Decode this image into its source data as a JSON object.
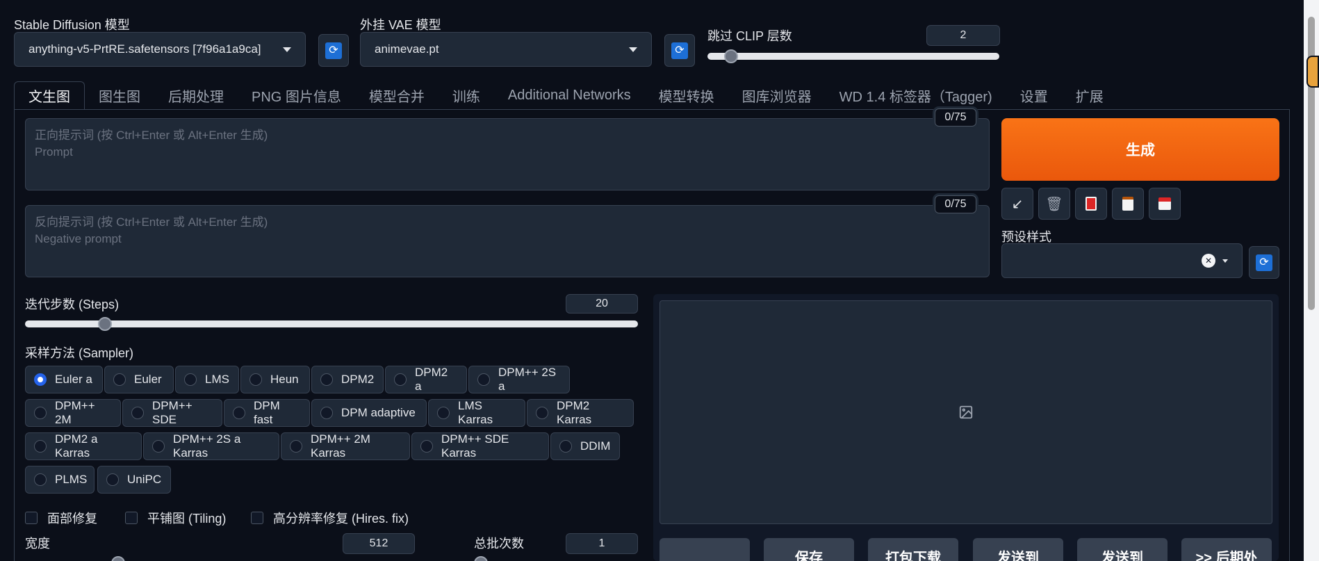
{
  "models": {
    "sd_label": "Stable Diffusion 模型",
    "sd_value": "anything-v5-PrtRE.safetensors [7f96a1a9ca]",
    "vae_label": "外挂 VAE 模型",
    "vae_value": "animevae.pt",
    "clip_label": "跳过 CLIP 层数",
    "clip_value": "2",
    "clip_fraction": 0.08
  },
  "tabs": [
    {
      "label": "文生图",
      "active": true
    },
    {
      "label": "图生图"
    },
    {
      "label": "后期处理"
    },
    {
      "label": "PNG 图片信息"
    },
    {
      "label": "模型合并"
    },
    {
      "label": "训练"
    },
    {
      "label": "Additional Networks"
    },
    {
      "label": "模型转换"
    },
    {
      "label": "图库浏览器"
    },
    {
      "label": "WD 1.4 标签器（Tagger)"
    },
    {
      "label": "设置"
    },
    {
      "label": "扩展"
    }
  ],
  "prompt": {
    "placeholder_line1": "正向提示词 (按 Ctrl+Enter 或 Alt+Enter 生成)",
    "placeholder_line2": "Prompt",
    "counter": "0/75"
  },
  "negative_prompt": {
    "placeholder_line1": "反向提示词 (按 Ctrl+Enter 或 Alt+Enter 生成)",
    "placeholder_line2": "Negative prompt",
    "counter": "0/75"
  },
  "generate": {
    "label": "生成",
    "tools": [
      "arrow-icon",
      "trash-icon",
      "card-icon",
      "clipboard-icon",
      "save-icon"
    ],
    "styles_label": "预设样式",
    "clear_glyph": "✕"
  },
  "steps": {
    "label": "迭代步数 (Steps)",
    "value": "20",
    "fraction": 0.13
  },
  "sampler": {
    "label": "采样方法 (Sampler)",
    "selected": "Euler a",
    "options": [
      "Euler a",
      "Euler",
      "LMS",
      "Heun",
      "DPM2",
      "DPM2 a",
      "DPM++ 2S a",
      "DPM++ 2M",
      "DPM++ SDE",
      "DPM fast",
      "DPM adaptive",
      "LMS Karras",
      "DPM2 Karras",
      "DPM2 a Karras",
      "DPM++ 2S a Karras",
      "DPM++ 2M Karras",
      "DPM++ SDE Karras",
      "DDIM",
      "PLMS",
      "UniPC"
    ]
  },
  "checkboxes": {
    "face": "面部修复",
    "tiling": "平铺图 (Tiling)",
    "hires": "高分辨率修复 (Hires. fix)"
  },
  "width": {
    "label": "宽度",
    "value": "512"
  },
  "batch_count": {
    "label": "总批次数",
    "value": "1"
  },
  "output_buttons": [
    "",
    "保存",
    "打包下载",
    "发送到",
    "发送到",
    ">> 后期处"
  ]
}
